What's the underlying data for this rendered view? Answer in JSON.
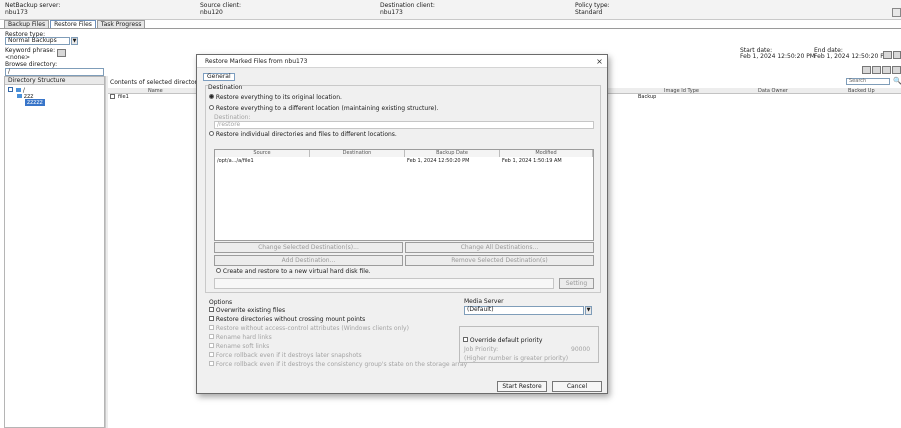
{
  "header": {
    "netbackup_server_label": "NetBackup server:",
    "netbackup_server_value": "nbu173",
    "source_client_label": "Source client:",
    "source_client_value": "nbu120",
    "destination_client_label": "Destination client:",
    "destination_client_value": "nbu173",
    "policy_type_label": "Policy type:",
    "policy_type_value": "Standard"
  },
  "tabs": [
    {
      "label": "Backup Files"
    },
    {
      "label": "Restore Files"
    },
    {
      "label": "Task Progress"
    }
  ],
  "left": {
    "restore_type_label": "Restore type:",
    "restore_type_value": "Normal Backups",
    "keyword_label": "Keyword phrase:",
    "keyword_value": "<none>",
    "browse_label": "Browse directory:",
    "browse_value": "/",
    "dir_structure_label": "Directory Structure",
    "tree": [
      {
        "label": "/"
      },
      {
        "label": "zzz"
      },
      {
        "label": "zzzzz"
      }
    ]
  },
  "right": {
    "start_date_label": "Start date:",
    "start_date_value": "Feb 1, 2024 12:50:20 PM",
    "end_date_label": "End date:",
    "end_date_value": "Feb 1, 2024 12:50:20 PM",
    "contents_label": "Contents of selected directory",
    "search_placeholder": "Search",
    "columns": [
      "Name",
      "Image Id Type",
      "Data Owner",
      "Backed Up"
    ],
    "row_name": "file1",
    "row_type": "Backup"
  },
  "dialog": {
    "title": "Restore Marked Files from nbu173",
    "close_glyph": "×",
    "tab_general": "General",
    "destination_legend": "Destination",
    "radio_original": "Restore everything to its original location.",
    "radio_different": "Restore everything to a different location (maintaining existing structure).",
    "destination_field_label": "Destination:",
    "destination_field_value": "/restore",
    "radio_individual": "Restore individual directories and files to different locations.",
    "table_headers": [
      "Source",
      "Destination",
      "Backup Date",
      "Modified"
    ],
    "table_row": [
      "/opt/a.../a/file1",
      "",
      "Feb 1, 2024 12:50:20 PM",
      "Feb 1, 2024 1:50:19 AM"
    ],
    "btn_change_selected": "Change Selected Destination(s)...",
    "btn_change_all": "Change All Destinations...",
    "btn_add": "Add Destination...",
    "btn_remove": "Remove Selected Destination(s)",
    "vhd_label": "Create and restore to a new virtual hard disk file.",
    "btn_setting": "Setting",
    "options_legend": "Options",
    "options": [
      {
        "label": "Overwrite existing files",
        "enabled": true
      },
      {
        "label": "Restore directories without crossing mount points",
        "enabled": true
      },
      {
        "label": "Restore without access-control attributes (Windows clients only)",
        "enabled": false
      },
      {
        "label": "Rename hard links",
        "enabled": false
      },
      {
        "label": "Rename soft links",
        "enabled": false
      },
      {
        "label": "Force rollback even if it destroys later snapshots",
        "enabled": false
      },
      {
        "label": "Force rollback even if it destroys the consistency group's state on the storage array",
        "enabled": false
      }
    ],
    "media_server_label": "Media Server",
    "media_server_value": "(Default)",
    "override_priority_label": "Override default priority",
    "job_priority_label": "Job Priority:",
    "job_priority_value": "90000",
    "priority_hint": "(Higher number is greater priority)",
    "btn_start": "Start Restore",
    "btn_cancel": "Cancel"
  }
}
